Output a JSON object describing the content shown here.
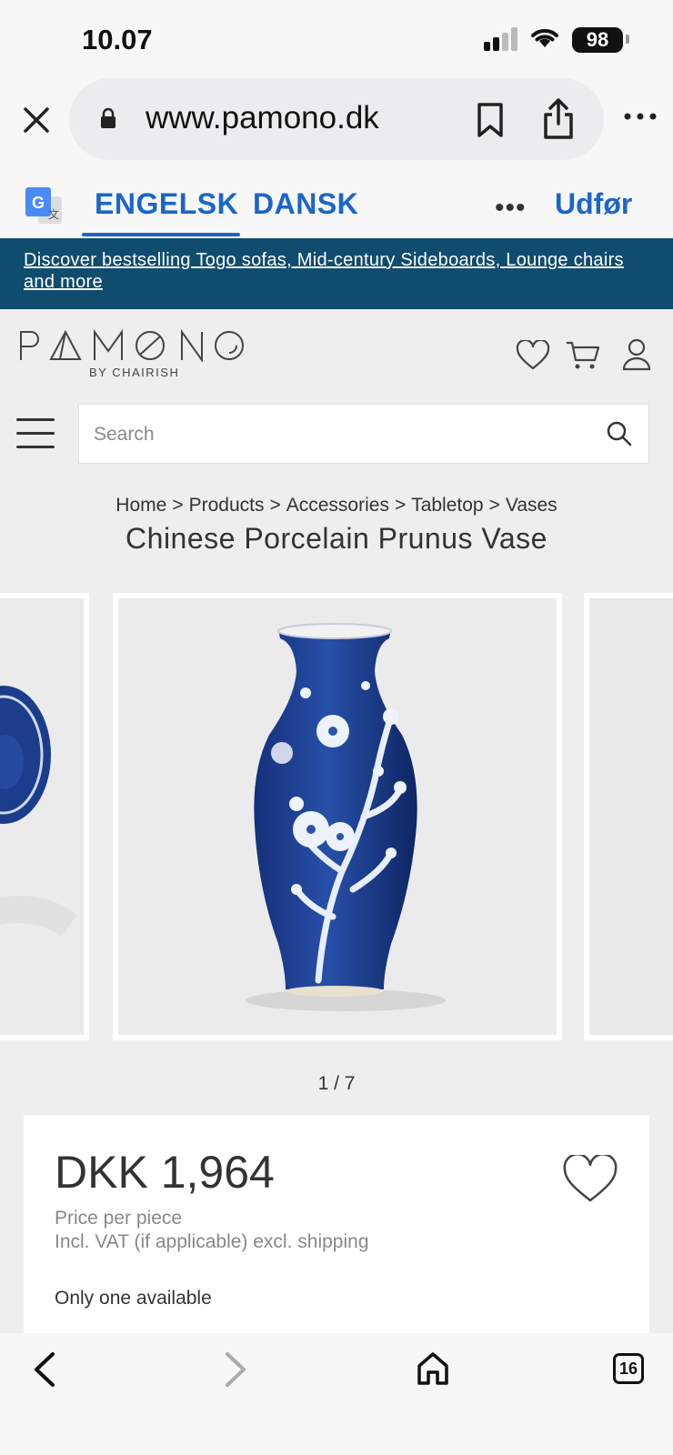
{
  "status_bar": {
    "time": "10.07",
    "battery": "98"
  },
  "browser": {
    "url": "www.pamono.dk",
    "icons": [
      "close-icon",
      "lock-icon",
      "bookmark-icon",
      "share-icon",
      "more-icon"
    ]
  },
  "translate_bar": {
    "language_source": "ENGELSK",
    "language_target": "DANSK",
    "more": "•••",
    "done": "Udfør",
    "accent": "#1a66c8"
  },
  "promo": {
    "text": "Discover bestselling Togo sofas, Mid-century Sideboards, Lounge chairs and more",
    "background": "#0f4c6e"
  },
  "site_header": {
    "logo_text": "PAMONO",
    "logo_sub": "BY CHAIRISH",
    "icons": [
      "heart-icon",
      "cart-icon",
      "user-icon",
      "menu-icon",
      "search-icon"
    ]
  },
  "search": {
    "placeholder": "Search"
  },
  "breadcrumb": [
    "Home",
    "Products",
    "Accessories",
    "Tabletop",
    "Vases"
  ],
  "breadcrumb_sep": ">",
  "product": {
    "title": "Chinese Porcelain Prunus Vase",
    "gallery_counter": "1 / 7",
    "price": "DKK 1,964",
    "price_note": "Price per piece",
    "vat_note": "Incl. VAT (if applicable) excl. shipping",
    "availability": "Only one available"
  },
  "bottom_toolbar": {
    "tab_count": "16",
    "icons": [
      "back-icon",
      "forward-icon",
      "home-icon",
      "tabs-icon"
    ]
  }
}
